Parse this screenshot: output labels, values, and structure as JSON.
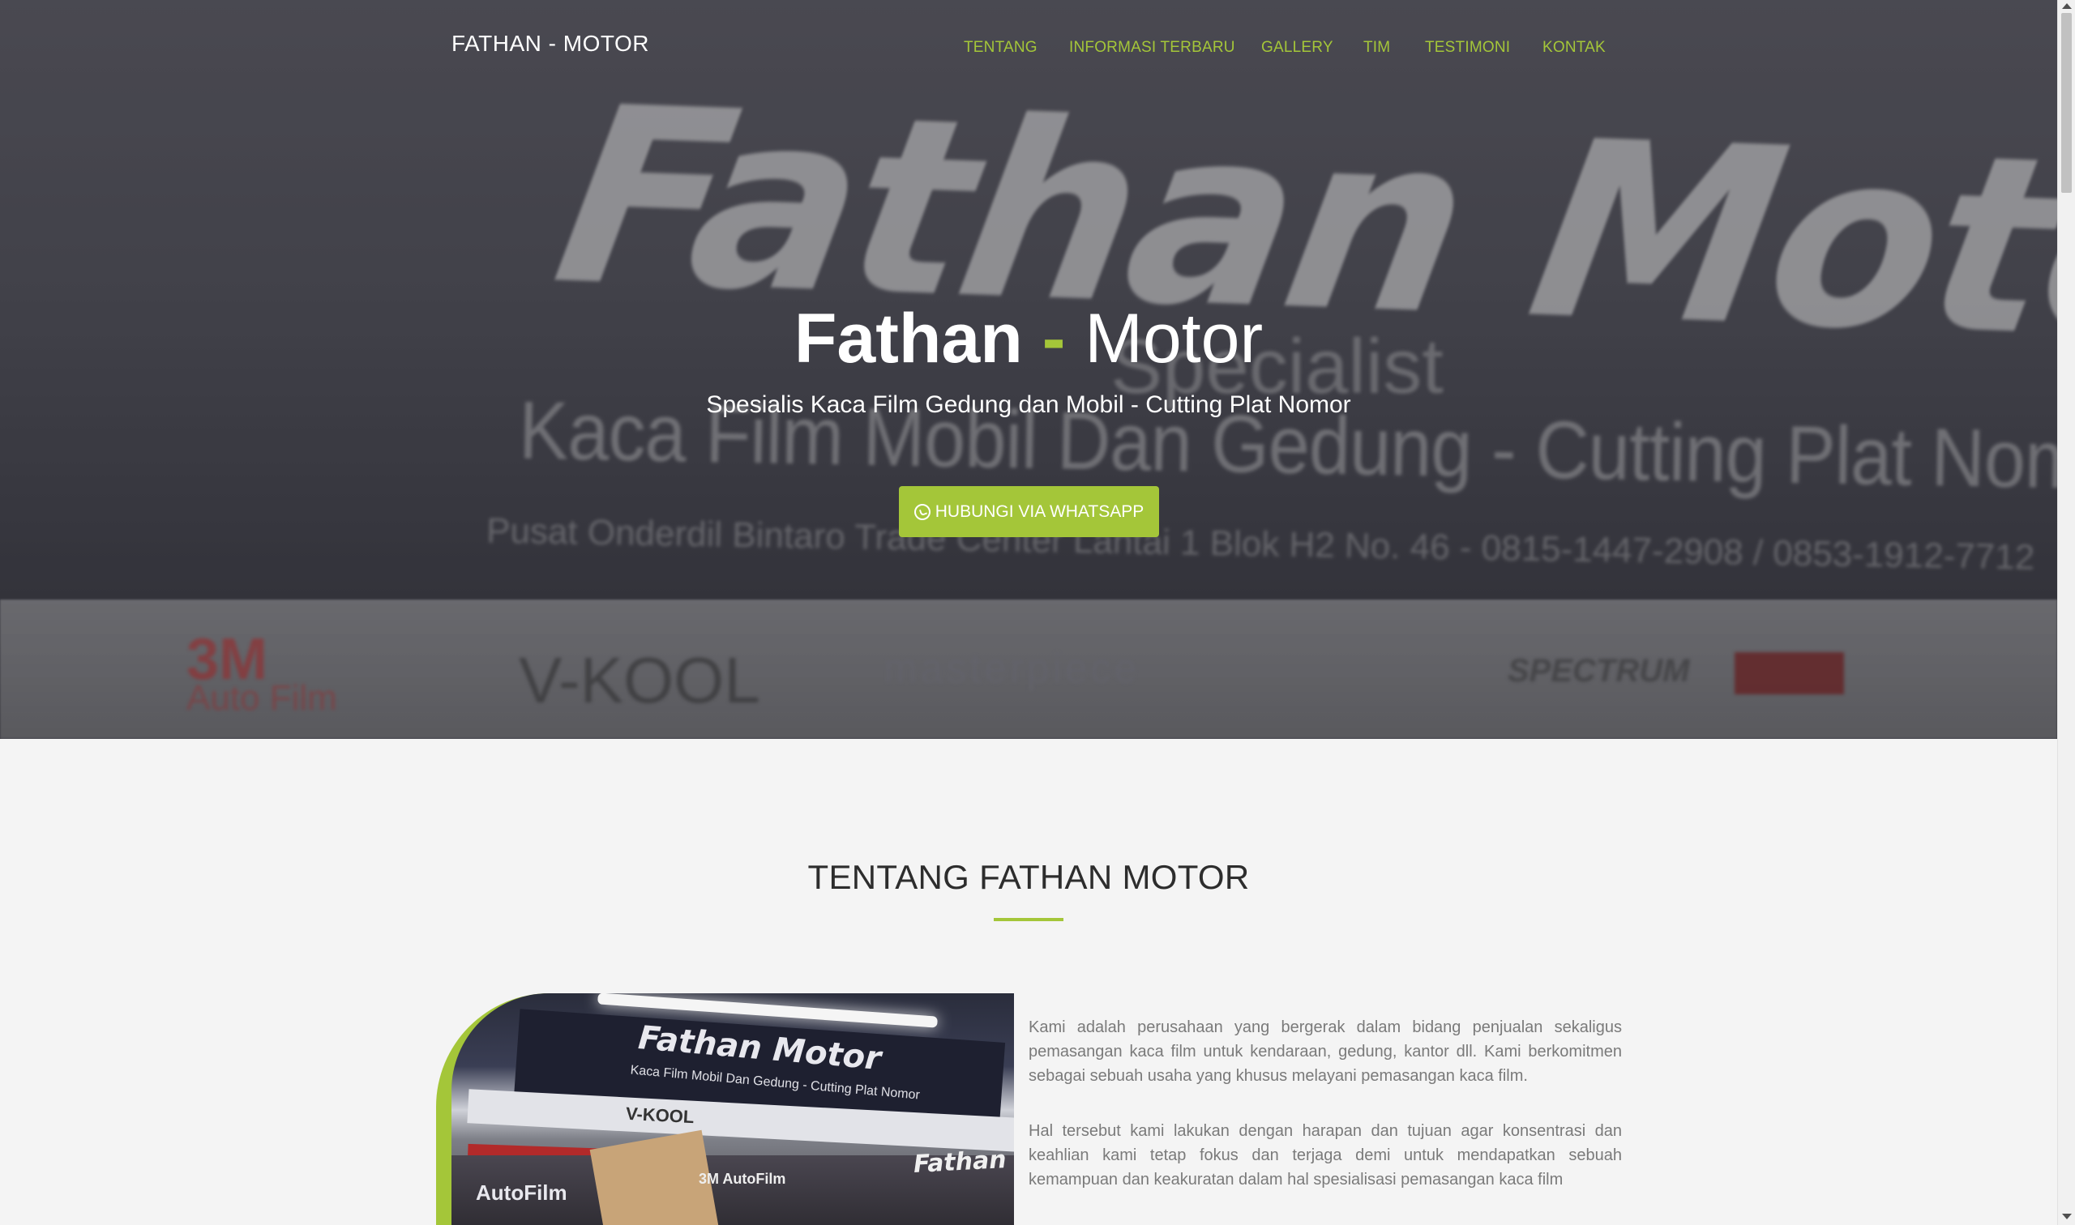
{
  "nav": {
    "brand": "FATHAN - MOTOR",
    "items": [
      {
        "label": "TENTANG"
      },
      {
        "label": "INFORMASI TERBARU"
      },
      {
        "label": "GALLERY"
      },
      {
        "label": "TIM"
      },
      {
        "label": "TESTIMONI"
      },
      {
        "label": "KONTAK"
      }
    ]
  },
  "hero": {
    "title_bold": "Fathan",
    "title_dash": "-",
    "title_light": "Motor",
    "subtitle": "Spesialis Kaca Film Gedung dan Mobil - Cutting Plat Nomor",
    "cta_label": "HUBUNGI VIA WHATSAPP",
    "cta_icon": "whatsapp-icon",
    "banner": {
      "headline": "Fathan Motor",
      "tag": "Specialist",
      "line": "Kaca Film Mobil Dan Gedung - Cutting Plat Nomor",
      "address": "Pusat Onderdil Bintaro Trade Center Lantai 1 Blok H2 No. 46 - 0815-1447-2908 / 0853-1912-7712",
      "logos": [
        "3M",
        "Auto Film",
        "V-KOOL",
        "masterpiece",
        "LLumar",
        "SPECTRUM"
      ]
    }
  },
  "about": {
    "title": "TENTANG FATHAN MOTOR",
    "paragraphs": [
      "Kami adalah perusahaan yang bergerak dalam bidang penjualan sekaligus pemasangan kaca film untuk kendaraan, gedung, kantor dll. Kami berkomitmen sebagai sebuah usaha yang khusus melayani pemasangan kaca film.",
      "Hal tersebut kami lakukan dengan harapan dan tujuan agar konsentrasi dan keahlian kami tetap fokus dan terjaga demi untuk mendapatkan sebuah kemampuan dan keakuratan dalam hal spesialisasi pemasangan kaca film"
    ],
    "photo": {
      "sign_title": "Fathan Motor",
      "sign_line": "Kaca Film Mobil Dan Gedung - Cutting Plat Nomor",
      "kool": "V-KOOL",
      "autofilm": "AutoFilm",
      "autofilm_small": "3M AutoFilm",
      "fathan": "Fathan"
    }
  },
  "colors": {
    "accent": "#a4c639",
    "heading": "#2d2d2d",
    "body_text": "#7a7a7a",
    "page_bg": "#f4f4f4"
  }
}
